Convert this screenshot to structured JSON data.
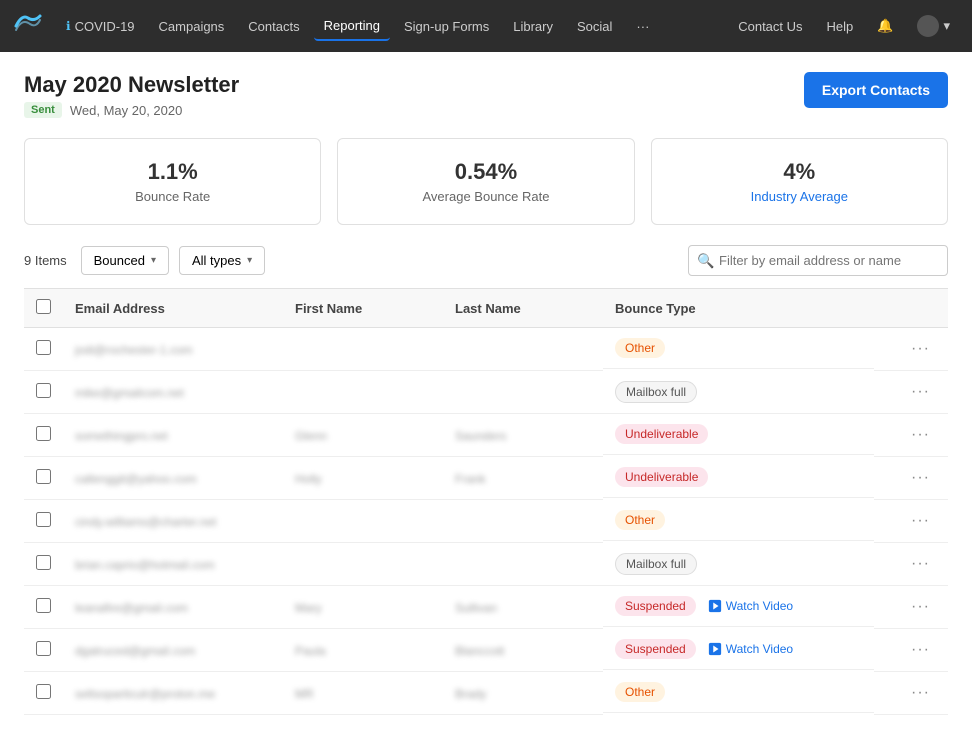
{
  "nav": {
    "items": [
      {
        "label": "COVID-19",
        "icon": "info-icon",
        "active": false
      },
      {
        "label": "Campaigns",
        "active": false
      },
      {
        "label": "Contacts",
        "active": false
      },
      {
        "label": "Reporting",
        "active": true
      },
      {
        "label": "Sign-up Forms",
        "active": false
      },
      {
        "label": "Library",
        "active": false
      },
      {
        "label": "Social",
        "active": false
      },
      {
        "label": "···",
        "active": false
      }
    ],
    "right_items": [
      {
        "label": "Contact Us"
      },
      {
        "label": "Help"
      },
      {
        "label": "🔔"
      },
      {
        "label": "Account ▾"
      }
    ]
  },
  "page": {
    "title": "May 2020 Newsletter",
    "badge": "Sent",
    "date": "Wed, May 20, 2020",
    "export_btn": "Export Contacts"
  },
  "stats": [
    {
      "value": "1.1%",
      "label": "Bounce Rate"
    },
    {
      "value": "0.54%",
      "label": "Average Bounce Rate"
    },
    {
      "value": "4%",
      "label": "Industry Average",
      "blue": true
    }
  ],
  "filter": {
    "items_count": "9 Items",
    "filter1_label": "Bounced",
    "filter2_label": "All types",
    "search_placeholder": "Filter by email address or name"
  },
  "table": {
    "headers": [
      "",
      "Email Address",
      "First Name",
      "Last Name",
      "Bounce Type",
      ""
    ],
    "rows": [
      {
        "email": "jodi@rochester-1.com",
        "first": "",
        "last": "",
        "bounce_type": "Other",
        "badge_class": "badge-other",
        "watch_video": false
      },
      {
        "email": "mike@gmailcom.net",
        "first": "",
        "last": "",
        "bounce_type": "Mailbox full",
        "badge_class": "badge-mailbox",
        "watch_video": false
      },
      {
        "email": "somethingpro.net",
        "first": "Glenn",
        "last": "Saunders",
        "bounce_type": "Undeliverable",
        "badge_class": "badge-undeliverable",
        "watch_video": false
      },
      {
        "email": "callenggit@yahoo.com",
        "first": "Holly",
        "last": "Frank",
        "bounce_type": "Undeliverable",
        "badge_class": "badge-undeliverable",
        "watch_video": false
      },
      {
        "email": "cindy.williams@charter.net",
        "first": "",
        "last": "",
        "bounce_type": "Other",
        "badge_class": "badge-other",
        "watch_video": false
      },
      {
        "email": "brian.caprio@hotmail.com",
        "first": "",
        "last": "",
        "bounce_type": "Mailbox full",
        "badge_class": "badge-mailbox",
        "watch_video": false
      },
      {
        "email": "leanafire@gmail.com",
        "first": "Mary",
        "last": "Sullivan",
        "bounce_type": "Suspended",
        "badge_class": "badge-suspended",
        "watch_video": true
      },
      {
        "email": "dgatruced@gmail.com",
        "first": "Paula",
        "last": "Blanccott",
        "bounce_type": "Suspended",
        "badge_class": "badge-suspended",
        "watch_video": true
      },
      {
        "email": "seltsoparticulr@proton.me",
        "first": "MR",
        "last": "Brady",
        "bounce_type": "Other",
        "badge_class": "badge-other",
        "watch_video": false
      }
    ],
    "watch_video_label": "Watch Video"
  }
}
